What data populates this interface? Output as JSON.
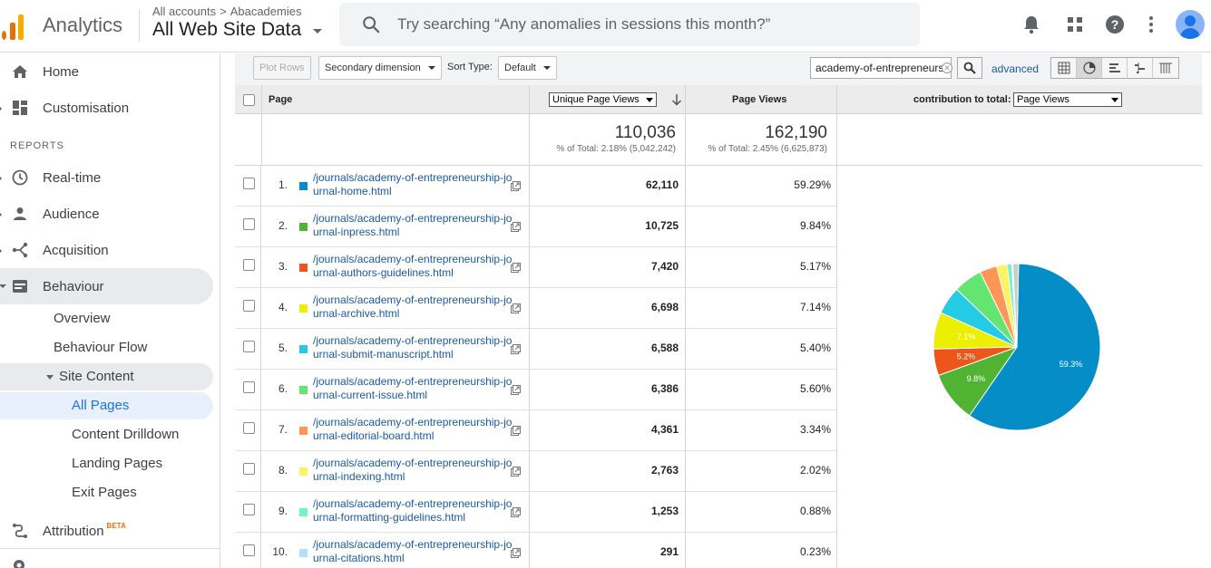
{
  "header": {
    "app_name": "Analytics",
    "breadcrumb_root": "All accounts",
    "breadcrumb_sep": ">",
    "breadcrumb_account": "Abacademies",
    "view_name": "All Web Site Data",
    "search_placeholder": "Try searching “Any anomalies in sessions this month?”",
    "icons": [
      "bell-icon",
      "apps-icon",
      "help-icon",
      "more-vert-icon",
      "account-avatar"
    ]
  },
  "sidebar": {
    "home": "Home",
    "customisation": "Customisation",
    "reports_header": "REPORTS",
    "realtime": "Real-time",
    "audience": "Audience",
    "acquisition": "Acquisition",
    "behaviour": "Behaviour",
    "behaviour_items": {
      "overview": "Overview",
      "flow": "Behaviour Flow",
      "site_content": "Site Content",
      "all_pages": "All Pages",
      "drilldown": "Content Drilldown",
      "landing": "Landing Pages",
      "exit": "Exit Pages"
    },
    "attribution": "Attribution",
    "attribution_badge": "BETA"
  },
  "toolbar": {
    "plot_rows": "Plot Rows",
    "secondary_dimension": "Secondary dimension",
    "sort_type_label": "Sort Type:",
    "sort_type_value": "Default",
    "filter_value": "academy-of-entrepreneurs",
    "advanced": "advanced"
  },
  "table": {
    "col_page": "Page",
    "col_metric_select": "Unique Page Views",
    "col_pageviews": "Page Views",
    "contrib_label": "contribution to total:",
    "contrib_select": "Page Views",
    "totals": {
      "unique_total": "110,036",
      "unique_pct": "% of Total: 2.18% (5,042,242)",
      "pv_total": "162,190",
      "pv_pct": "% of Total: 2.45% (6,625,873)"
    },
    "rows": [
      {
        "num": "1.",
        "url": "/journals/academy-of-entrepreneurship-journal-home.html",
        "unique": "62,110",
        "pct": "59.29%",
        "color": "#058dc7"
      },
      {
        "num": "2.",
        "url": "/journals/academy-of-entrepreneurship-journal-inpress.html",
        "unique": "10,725",
        "pct": "9.84%",
        "color": "#50b432"
      },
      {
        "num": "3.",
        "url": "/journals/academy-of-entrepreneurship-journal-authors-guidelines.html",
        "unique": "7,420",
        "pct": "5.17%",
        "color": "#ed561b"
      },
      {
        "num": "4.",
        "url": "/journals/academy-of-entrepreneurship-journal-archive.html",
        "unique": "6,698",
        "pct": "7.14%",
        "color": "#edef00"
      },
      {
        "num": "5.",
        "url": "/journals/academy-of-entrepreneurship-journal-submit-manuscript.html",
        "unique": "6,588",
        "pct": "5.40%",
        "color": "#24cbe5"
      },
      {
        "num": "6.",
        "url": "/journals/academy-of-entrepreneurship-journal-current-issue.html",
        "unique": "6,386",
        "pct": "5.60%",
        "color": "#64e572"
      },
      {
        "num": "7.",
        "url": "/journals/academy-of-entrepreneurship-journal-editorial-board.html",
        "unique": "4,361",
        "pct": "3.34%",
        "color": "#ff9655"
      },
      {
        "num": "8.",
        "url": "/journals/academy-of-entrepreneurship-journal-indexing.html",
        "unique": "2,763",
        "pct": "2.02%",
        "color": "#fff263"
      },
      {
        "num": "9.",
        "url": "/journals/academy-of-entrepreneurship-journal-formatting-guidelines.html",
        "unique": "1,253",
        "pct": "0.88%",
        "color": "#6af9c4"
      },
      {
        "num": "10.",
        "url": "/journals/academy-of-entrepreneurship-journal-citations.html",
        "unique": "291",
        "pct": "0.23%",
        "color": "#b2deff"
      }
    ]
  },
  "chart_data": {
    "type": "pie",
    "categories": [
      "1.",
      "2.",
      "3.",
      "4.",
      "5.",
      "6.",
      "7.",
      "8.",
      "9.",
      "10.",
      "other"
    ],
    "values": [
      59.29,
      9.84,
      5.17,
      7.14,
      5.4,
      5.6,
      3.34,
      2.02,
      0.88,
      0.23,
      1.09
    ],
    "colors": [
      "#058dc7",
      "#50b432",
      "#ed561b",
      "#edef00",
      "#24cbe5",
      "#64e572",
      "#ff9655",
      "#fff263",
      "#6af9c4",
      "#b2deff",
      "#cccccc"
    ],
    "slice_labels": [
      "59.3%",
      "9.8%",
      "5.2%",
      "7.1%",
      "",
      "",
      "",
      "",
      "",
      "",
      ""
    ]
  }
}
